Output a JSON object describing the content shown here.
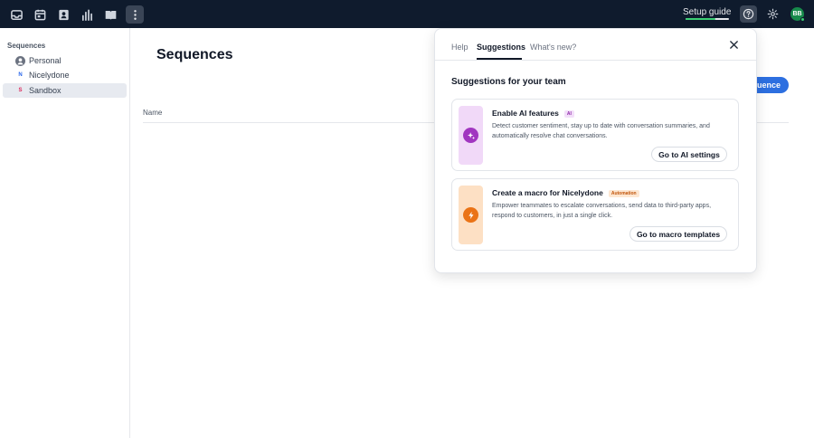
{
  "topbar": {
    "icons": [
      "inbox-icon",
      "calendar-icon",
      "contacts-icon",
      "reports-icon",
      "book-icon",
      "more-vertical-icon"
    ],
    "setup_guide_label": "Setup guide",
    "setup_progress": 0.68,
    "avatar_initials": "BB"
  },
  "sidebar": {
    "title": "Sequences",
    "items": [
      {
        "label": "Personal",
        "icon": "person-icon"
      },
      {
        "label": "Nicelydone",
        "icon_letter": "N"
      },
      {
        "label": "Sandbox",
        "icon_letter": "S",
        "selected": true
      }
    ]
  },
  "main": {
    "title": "Sequences",
    "new_button_label": "quence",
    "column_name": "Name"
  },
  "popover": {
    "tabs": [
      {
        "label": "Help"
      },
      {
        "label": "Suggestions",
        "active": true
      },
      {
        "label": "What's new?"
      }
    ],
    "section_title": "Suggestions for your team",
    "cards": [
      {
        "title": "Enable AI features",
        "badge": "AI",
        "description": "Detect customer sentiment, stay up to date with conversation summaries, and automatically resolve chat conversations.",
        "button": "Go to AI settings",
        "icon": "sparkle-icon",
        "thumb_color": "#f1d9f8",
        "circle_color": "#a136c0",
        "badge_bg": "#f3dff9",
        "badge_color": "#8e2aaa"
      },
      {
        "title": "Create a macro for Nicelydone",
        "badge": "Automation",
        "description": "Empower teammates to escalate conversations, send data to third-party apps, respond to customers, in just a single click.",
        "button": "Go to macro templates",
        "icon": "lightning-icon",
        "thumb_color": "#fde0c4",
        "circle_color": "#ea7316",
        "badge_bg": "#fde7d2",
        "badge_color": "#c2560c"
      }
    ]
  },
  "colors": {
    "topbar_bg": "#0f1b2d",
    "accent_blue": "#2d6fe0",
    "progress_green": "#3ccf74"
  }
}
